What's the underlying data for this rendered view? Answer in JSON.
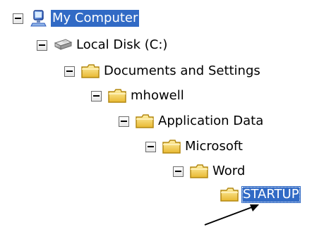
{
  "tree": {
    "my_computer": {
      "label": "My Computer",
      "icon": "computer-icon",
      "expanded": true,
      "selected": true
    },
    "local_disk": {
      "label": "Local Disk (C:)",
      "icon": "hard-drive-icon",
      "expanded": true
    },
    "documents_and_settings": {
      "label": "Documents and Settings",
      "icon": "folder-icon",
      "expanded": true
    },
    "mhowell": {
      "label": "mhowell",
      "icon": "folder-icon",
      "expanded": true
    },
    "application_data": {
      "label": "Application Data",
      "icon": "folder-icon",
      "expanded": true
    },
    "microsoft": {
      "label": "Microsoft",
      "icon": "folder-icon",
      "expanded": true
    },
    "word": {
      "label": "Word",
      "icon": "folder-icon",
      "expanded": true
    },
    "startup": {
      "label": "STARTUP",
      "icon": "folder-icon",
      "selected": true
    }
  },
  "colors": {
    "selection": "#316ac5",
    "selection_text": "#ffffff",
    "folder": "#f3c84f"
  },
  "annotation": {
    "icon": "arrow-icon"
  }
}
